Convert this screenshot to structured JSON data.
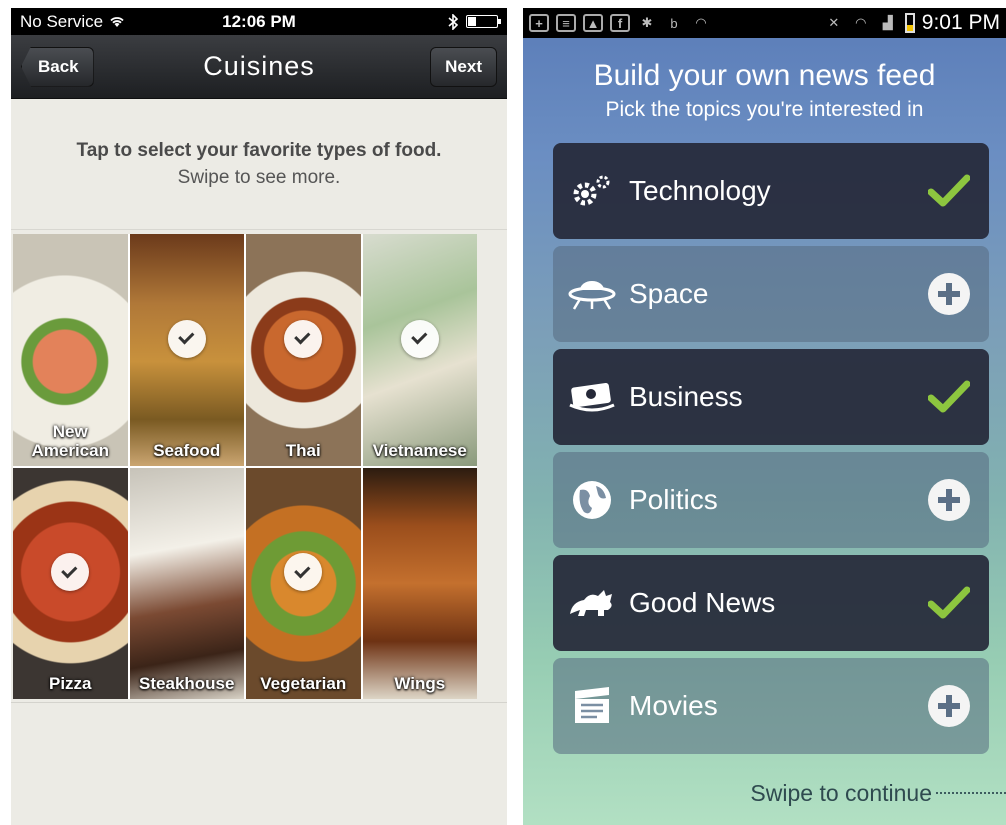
{
  "left_screen": {
    "status": {
      "carrier": "No Service",
      "time": "12:06 PM"
    },
    "nav": {
      "back_label": "Back",
      "title": "Cuisines",
      "next_label": "Next"
    },
    "intro": {
      "line1": "Tap to select your favorite types of food.",
      "line2": "Swipe to see more."
    },
    "cuisines": [
      {
        "label": "New American",
        "selected": false
      },
      {
        "label": "Seafood",
        "selected": true
      },
      {
        "label": "Thai",
        "selected": true
      },
      {
        "label": "Vietnamese",
        "selected": true
      },
      {
        "label": "Pizza",
        "selected": true
      },
      {
        "label": "Steakhouse",
        "selected": false
      },
      {
        "label": "Vegetarian",
        "selected": true
      },
      {
        "label": "Wings",
        "selected": false
      }
    ]
  },
  "right_screen": {
    "status": {
      "time": "9:01 PM"
    },
    "title": "Build your own news feed",
    "subtitle": "Pick the topics you're interested in",
    "topics": [
      {
        "label": "Technology",
        "icon": "gears-icon",
        "selected": true
      },
      {
        "label": "Space",
        "icon": "ufo-icon",
        "selected": false
      },
      {
        "label": "Business",
        "icon": "money-icon",
        "selected": true
      },
      {
        "label": "Politics",
        "icon": "globe-icon",
        "selected": false
      },
      {
        "label": "Good News",
        "icon": "animal-icon",
        "selected": true
      },
      {
        "label": "Movies",
        "icon": "clapperboard-icon",
        "selected": false
      }
    ],
    "swipe_label": "Swipe to continue"
  },
  "colors": {
    "check_green": "#8dc63f",
    "topic_selected_bg": "#252838",
    "nav_dark": "#1d1f22"
  }
}
